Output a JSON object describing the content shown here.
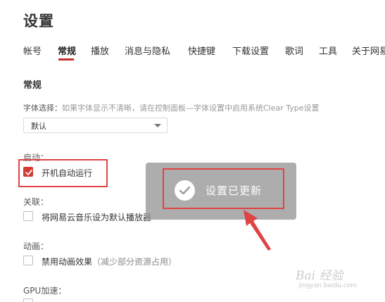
{
  "page": {
    "title": "设置"
  },
  "tabs": [
    {
      "label": "帐号"
    },
    {
      "label": "常规"
    },
    {
      "label": "播放"
    },
    {
      "label": "消息与隐私"
    },
    {
      "label": "快捷键"
    },
    {
      "label": "下载设置"
    },
    {
      "label": "歌词"
    },
    {
      "label": "工具"
    },
    {
      "label": "关于网易"
    }
  ],
  "general": {
    "section_title": "常规",
    "font": {
      "label": "字体选择：",
      "hint": "如果字体显示不清晰，请在控制面板—字体设置中启用系统Clear Type设置",
      "selected": "默认"
    },
    "startup": {
      "label": "启动：",
      "option": "开机自动运行",
      "checked": true
    },
    "association": {
      "label": "关联：",
      "option": "将网易云音乐设为默认播放器",
      "checked": false
    },
    "animation": {
      "label": "动画：",
      "option": "禁用动画效果",
      "note": "（减少部分资源占用）",
      "checked": false
    },
    "gpu": {
      "label": "GPU加速："
    }
  },
  "toast": {
    "message": "设置已更新"
  },
  "watermark": {
    "main": "Bai 经验",
    "sub": "jingyan.baidu.com"
  },
  "colors": {
    "accent": "#c62f2f",
    "checkbox_checked": "#d33a31",
    "annotation": "#e04343"
  }
}
